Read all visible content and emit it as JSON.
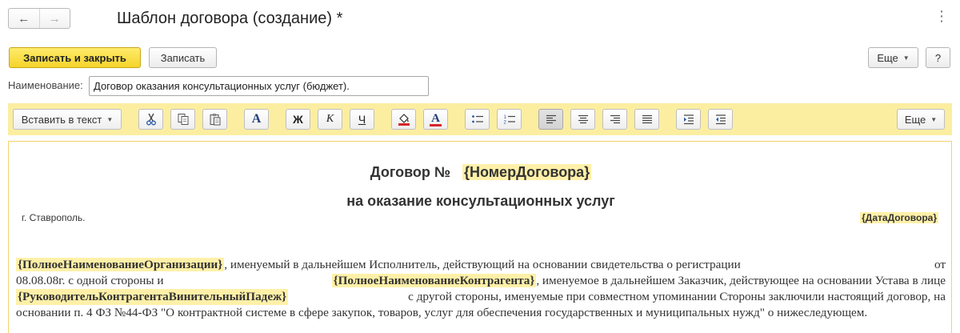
{
  "window": {
    "title": "Шаблон договора (создание) *",
    "back_icon": "←",
    "forward_icon": "→",
    "close_icon": "⋮"
  },
  "commands": {
    "save_close": "Записать и закрыть",
    "save": "Записать",
    "more": "Еще",
    "help": "?"
  },
  "name_field": {
    "label": "Наименование:",
    "value": "Договор оказания консультационных услуг (бюджет)."
  },
  "toolbar": {
    "insert_label": "Вставить в текст",
    "more": "Еще",
    "bold": "Ж",
    "italic": "К",
    "underline": "Ч",
    "font_glyph": "A",
    "font_color_glyph": "A"
  },
  "document": {
    "title_prefix": "Договор №",
    "title_field": "{НомерДоговора}",
    "subtitle": "на оказание консультационных услуг",
    "city": "г. Ставрополь.",
    "date_field": "{ДатаДоговора}",
    "line1": {
      "f1": "{ПолноеНаименованиеОрганизации}",
      "t1": ", именуемый в дальнейшем Исполнитель, действующий на основании свидетельства о регистрации",
      "t2": "от"
    },
    "line2": {
      "t1": "08.08.08г. с одной стороны и",
      "f1": "{ПолноеНаименованиеКонтрагента}",
      "t2": ", именуемое в дальнейшем Заказчик, действующее на основании Устава в лице"
    },
    "line3": {
      "f1": "{РуководительКонтрагентаВинительныйПадеж}",
      "t1": "с другой стороны, именуемые при совместном упоминании Стороны заключили настоящий договор, на"
    },
    "line4": {
      "t1": "основании п. 4 ФЗ №44-ФЗ \"О контрактной системе в сфере закупок, товаров, услуг для обеспечения государственных и муниципальных нужд\" о нижеследующем."
    }
  }
}
